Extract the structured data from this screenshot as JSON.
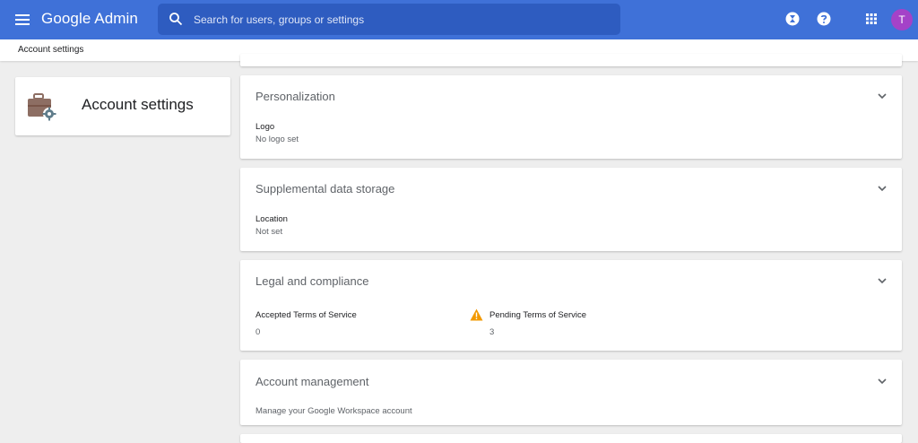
{
  "header": {
    "brand": "Google Admin",
    "search_placeholder": "Search for users, groups or settings",
    "avatar_initial": "T"
  },
  "breadcrumb": "Account settings",
  "sidebar": {
    "title": "Account settings"
  },
  "panels": {
    "personalization": {
      "title": "Personalization",
      "field_label": "Logo",
      "field_value": "No logo set"
    },
    "supplemental": {
      "title": "Supplemental data storage",
      "field_label": "Location",
      "field_value": "Not set"
    },
    "legal": {
      "title": "Legal and compliance",
      "accepted_label": "Accepted Terms of Service",
      "accepted_value": "0",
      "pending_label": "Pending Terms of Service",
      "pending_value": "3"
    },
    "account": {
      "title": "Account management",
      "description": "Manage your Google Workspace account"
    }
  },
  "colors": {
    "header_bg": "#3f71d8",
    "warning": "#f29900",
    "avatar_bg": "#a442c8"
  }
}
